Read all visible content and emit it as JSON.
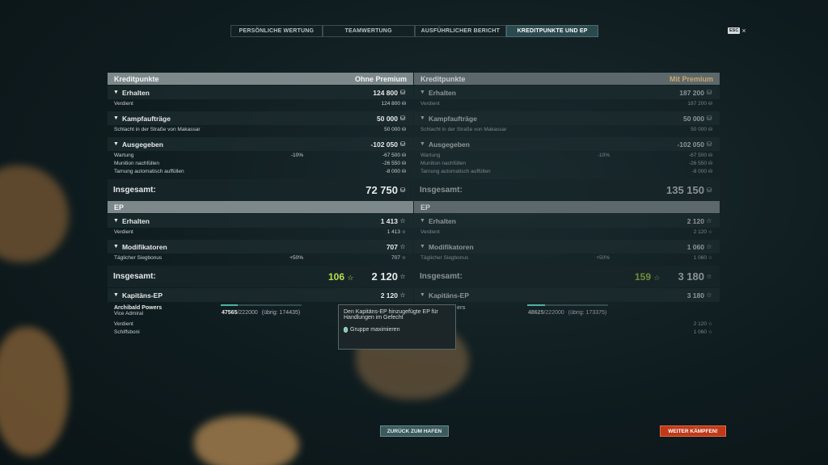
{
  "tabs": [
    "PERSÖNLICHE WERTUNG",
    "TEAMWERTUNG",
    "AUSFÜHRLICHER BERICHT",
    "KREDITPUNKTE UND EP"
  ],
  "esc": {
    "key": "ESC",
    "close": "×"
  },
  "icons": {
    "credits": "credits-coin-icon",
    "xp": "star-icon"
  },
  "left": {
    "credits_title": "Kreditpunkte",
    "premium_label": "Ohne Premium",
    "erhalten": {
      "label": "Erhalten",
      "value": "124 800",
      "rows": [
        {
          "label": "Verdient",
          "pct": "",
          "value": "124 800"
        }
      ]
    },
    "kampf": {
      "label": "Kampfaufträge",
      "value": "50 000",
      "rows": [
        {
          "label": "Schlacht in der Straße von Makassar",
          "pct": "",
          "value": "50 000"
        }
      ]
    },
    "ausgegeben": {
      "label": "Ausgegeben",
      "value": "-102 050",
      "rows": [
        {
          "label": "Wartung",
          "pct": "-10%",
          "value": "-67 500"
        },
        {
          "label": "Munition nachfüllen",
          "pct": "",
          "value": "-26 550"
        },
        {
          "label": "Tarnung automatisch auffüllen",
          "pct": "",
          "value": "-8 000"
        }
      ]
    },
    "total_label": "Insgesamt:",
    "total_credits": "72 750",
    "ep_title": "EP",
    "ep_erhalten": {
      "label": "Erhalten",
      "value": "1 413",
      "rows": [
        {
          "label": "Verdient",
          "pct": "",
          "value": "1 413"
        }
      ]
    },
    "ep_mod": {
      "label": "Modifikatoren",
      "value": "707",
      "rows": [
        {
          "label": "Täglicher Siegbonus",
          "pct": "+50%",
          "value": "707"
        }
      ]
    },
    "ep_total_label": "Insgesamt:",
    "ep_total_green": "106",
    "ep_total": "2 120",
    "captain": {
      "label": "Kapitäns-EP",
      "value": "2 120",
      "name": "Archibald Powers",
      "rank": "Vice Admiral",
      "xp_current": "47565",
      "xp_max": "/222000",
      "remaining": "(übrig: 174435)",
      "progress": 0.214,
      "rows": [
        {
          "label": "Verdient",
          "value": ""
        },
        {
          "label": "Schiffsboni",
          "value": ""
        }
      ]
    }
  },
  "right": {
    "credits_title": "Kreditpunkte",
    "premium_label": "Mit Premium",
    "erhalten": {
      "label": "Erhalten",
      "value": "187 200",
      "rows": [
        {
          "label": "Verdient",
          "pct": "",
          "value": "187 200"
        }
      ]
    },
    "kampf": {
      "label": "Kampfaufträge",
      "value": "50 000",
      "rows": [
        {
          "label": "Schlacht in der Straße von Makassar",
          "pct": "",
          "value": "50 000"
        }
      ]
    },
    "ausgegeben": {
      "label": "Ausgegeben",
      "value": "-102 050",
      "rows": [
        {
          "label": "Wartung",
          "pct": "-10%",
          "value": "-67 500"
        },
        {
          "label": "Munition nachfüllen",
          "pct": "",
          "value": "-26 550"
        },
        {
          "label": "Tarnung automatisch auffüllen",
          "pct": "",
          "value": "-8 000"
        }
      ]
    },
    "total_label": "Insgesamt:",
    "total_credits": "135 150",
    "ep_title": "EP",
    "ep_erhalten": {
      "label": "Erhalten",
      "value": "2 120",
      "rows": [
        {
          "label": "Verdient",
          "pct": "",
          "value": "2 120"
        }
      ]
    },
    "ep_mod": {
      "label": "Modifikatoren",
      "value": "1 060",
      "rows": [
        {
          "label": "Täglicher Siegbonus",
          "pct": "+50%",
          "value": "1 060"
        }
      ]
    },
    "ep_total_label": "Insgesamt:",
    "ep_total_green": "159",
    "ep_total": "3 180",
    "captain": {
      "label": "Kapitäns-EP",
      "value": "3 180",
      "name": "ers",
      "rank": "",
      "xp_current": "48625",
      "xp_max": "/222000",
      "remaining": "(übrig: 173375)",
      "progress": 0.219,
      "rows": [
        {
          "label": "",
          "value": "2 120"
        },
        {
          "label": "",
          "value": "1 060"
        }
      ]
    }
  },
  "tooltip": {
    "text": "Den Kapitäns-EP hinzugefügte EP für Handlungen im Gefecht",
    "hint": "Gruppe maximieren"
  },
  "buttons": {
    "port": "ZURÜCK ZUM HAFEN",
    "fight": "WEITER KÄMPFEN!"
  }
}
